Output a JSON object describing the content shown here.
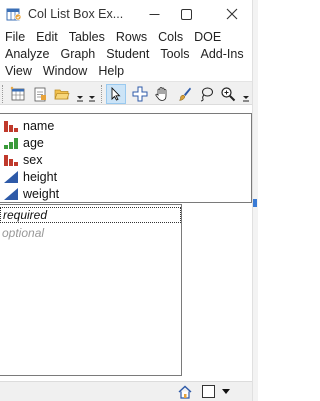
{
  "window": {
    "title": "Col List Box Ex...",
    "controls": {
      "minimize": "—",
      "maximize": "☐",
      "close": "✕"
    }
  },
  "menu": {
    "rows": [
      [
        "File",
        "Edit",
        "Tables",
        "Rows",
        "Cols",
        "DOE"
      ],
      [
        "Analyze",
        "Graph",
        "Student",
        "Tools",
        "Add-Ins"
      ],
      [
        "View",
        "Window",
        "Help"
      ]
    ]
  },
  "toolbar": {
    "icons": [
      "new-data-table-icon",
      "new-script-icon",
      "open-folder-icon",
      "arrow-pointer-icon",
      "crosshair-icon",
      "hand-grabber-icon",
      "brush-icon",
      "lasso-icon",
      "magnifier-icon"
    ],
    "active_tool": "arrow-pointer-icon"
  },
  "columns": [
    {
      "name": "name",
      "type": "nominal",
      "color": "#c0392b"
    },
    {
      "name": "age",
      "type": "ordinal",
      "color": "#3a9a3a"
    },
    {
      "name": "sex",
      "type": "nominal",
      "color": "#c0392b"
    },
    {
      "name": "height",
      "type": "continuous",
      "color": "#2e5aa8"
    },
    {
      "name": "weight",
      "type": "continuous",
      "color": "#2e5aa8"
    }
  ],
  "roles": {
    "required": "required",
    "optional": "optional"
  },
  "statusbar": {
    "icons": [
      "home-icon",
      "window-list-icon",
      "dropdown-arrow-icon"
    ]
  },
  "colors": {
    "accent": "#3a7bd5",
    "nominal": "#c0392b",
    "ordinal": "#3a9a3a",
    "continuous": "#2e5aa8"
  }
}
